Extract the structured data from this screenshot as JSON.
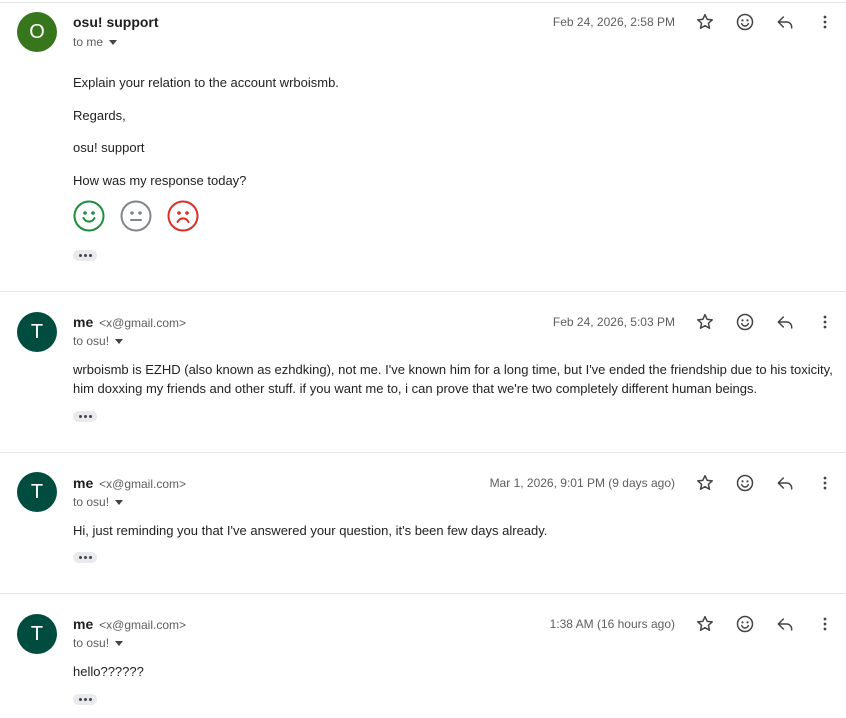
{
  "colors": {
    "avatar_o": "#38761d",
    "avatar_t": "#004d40",
    "face_happy": "#1e8e3e",
    "face_neutral": "#80868b",
    "face_sad": "#d93025"
  },
  "messages": [
    {
      "avatar_letter": "O",
      "sender_name": "osu! support",
      "sender_email": "",
      "to": "to me",
      "date": "Feb 24, 2026, 2:58 PM",
      "body": [
        "Explain your relation to the account wrboismb.",
        "Regards,",
        "osu! support",
        "How was my response today?"
      ],
      "feedback_icons": [
        "happy-face-icon",
        "neutral-face-icon",
        "sad-face-icon"
      ]
    },
    {
      "avatar_letter": "T",
      "sender_name": "me",
      "sender_email": "<x@gmail.com>",
      "to": "to osu!",
      "date": "Feb 24, 2026, 5:03 PM",
      "body": [
        "wrboismb is EZHD (also known as ezhdking), not me. I've known him for a long time, but I've ended the friendship due to his toxicity, him doxxing my friends and other stuff. if you want me to, i can prove that we're two completely different human beings."
      ]
    },
    {
      "avatar_letter": "T",
      "sender_name": "me",
      "sender_email": "<x@gmail.com>",
      "to": "to osu!",
      "date": "Mar 1, 2026, 9:01 PM (9 days ago)",
      "body": [
        "Hi, just reminding you that I've answered your question, it's been few days already."
      ]
    },
    {
      "avatar_letter": "T",
      "sender_name": "me",
      "sender_email": "<x@gmail.com>",
      "to": "to osu!",
      "date": "1:38 AM (16 hours ago)",
      "body": [
        "hello??????"
      ]
    }
  ],
  "icons": [
    "star-icon",
    "emoji-icon",
    "reply-icon",
    "more-vert-icon",
    "chevron-down-icon",
    "ellipsis-icon"
  ]
}
